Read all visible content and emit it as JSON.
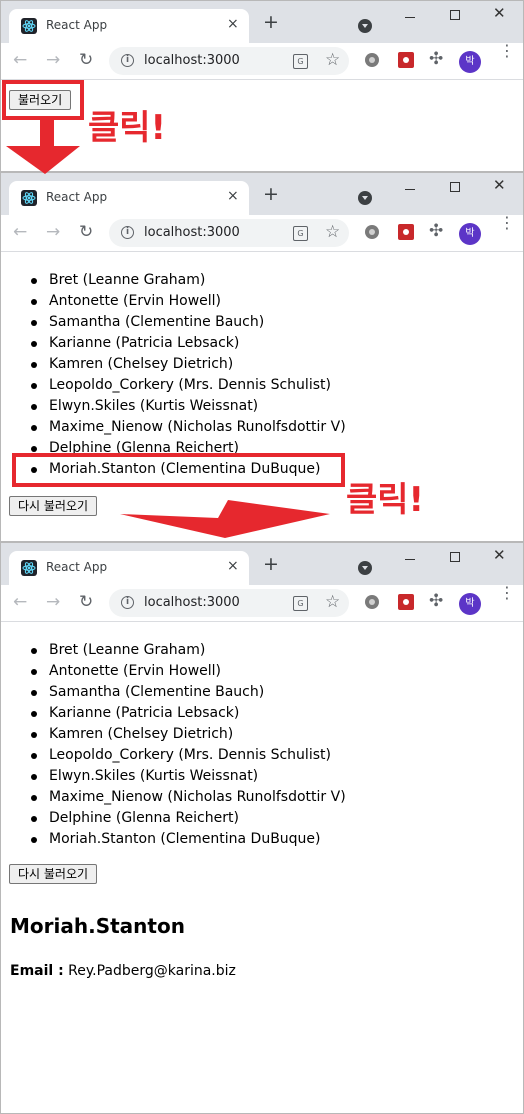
{
  "browser": {
    "tab_title": "React App",
    "tab_close": "×",
    "new_tab": "+",
    "url": "localhost:3000",
    "avatar_initial": "박",
    "icons": [
      "react-logo-icon",
      "close-icon",
      "plus-icon",
      "tab-search-icon",
      "minimize-icon",
      "maximize-icon",
      "window-close-icon",
      "back-icon",
      "forward-icon",
      "reload-icon",
      "info-icon",
      "translate-icon",
      "star-icon",
      "gear-extension-icon",
      "red-extension-icon",
      "puzzle-icon",
      "menu-icon"
    ]
  },
  "step1": {
    "load_button": "불러오기",
    "annotation": "클릭!"
  },
  "step2": {
    "reload_button": "다시 불러오기",
    "annotation": "클릭!"
  },
  "users": [
    "Bret (Leanne Graham)",
    "Antonette (Ervin Howell)",
    "Samantha (Clementine Bauch)",
    "Karianne (Patricia Lebsack)",
    "Kamren (Chelsey Dietrich)",
    "Leopoldo_Corkery (Mrs. Dennis Schulist)",
    "Elwyn.Skiles (Kurtis Weissnat)",
    "Maxime_Nienow (Nicholas Runolfsdottir V)",
    "Delphine (Glenna Reichert)",
    "Moriah.Stanton (Clementina DuBuque)"
  ],
  "step3": {
    "reload_button": "다시 불러오기",
    "detail_name": "Moriah.Stanton",
    "email_label": "Email :",
    "email_value": "Rey.Padberg@karina.biz"
  },
  "colors": {
    "annotation": "#e6282e",
    "avatar": "#5c35c7",
    "tabstrip": "#dee1e6"
  }
}
